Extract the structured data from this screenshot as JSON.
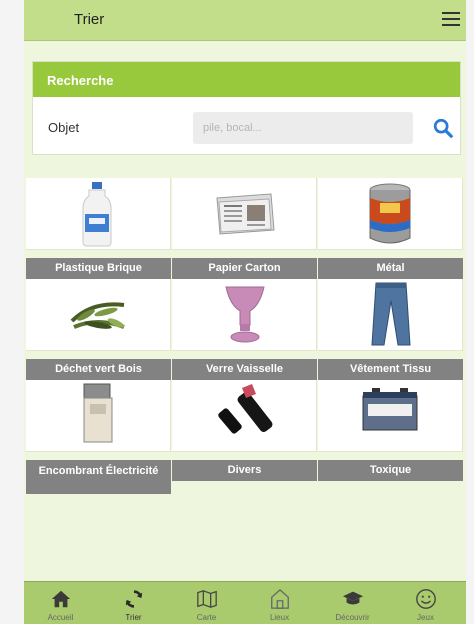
{
  "header": {
    "title": "Trier",
    "menu_icon": "hamburger-menu-icon"
  },
  "search": {
    "section_title": "Recherche",
    "field_label": "Objet",
    "placeholder": "pile, bocal...",
    "value": "",
    "button_icon": "search-icon"
  },
  "categories": [
    {
      "label": "Plastique Brique",
      "icon": "plastic-bottle-icon"
    },
    {
      "label": "Papier Carton",
      "icon": "newspaper-icon"
    },
    {
      "label": "Métal",
      "icon": "metal-can-icon"
    },
    {
      "label": "Déchet vert Bois",
      "icon": "green-waste-icon"
    },
    {
      "label": "Verre Vaisselle",
      "icon": "glass-vase-icon"
    },
    {
      "label": "Vêtement Tissu",
      "icon": "jeans-icon"
    },
    {
      "label": "Encombrant Électricité",
      "icon": "washing-machine-icon"
    },
    {
      "label": "Divers",
      "icon": "lipstick-icon"
    },
    {
      "label": "Toxique",
      "icon": "battery-icon"
    }
  ],
  "nav": [
    {
      "label": "Accueil",
      "icon": "home-icon"
    },
    {
      "label": "Trier",
      "icon": "recycle-icon",
      "active": true
    },
    {
      "label": "Carte",
      "icon": "map-icon"
    },
    {
      "label": "Lieux",
      "icon": "building-icon"
    },
    {
      "label": "Découvrir",
      "icon": "graduation-cap-icon"
    },
    {
      "label": "Jeux",
      "icon": "smiley-icon"
    }
  ],
  "colors": {
    "header": "#c2de8a",
    "accent": "#98c93c",
    "label_bg": "#828282",
    "search_icon": "#2a7bd6"
  }
}
